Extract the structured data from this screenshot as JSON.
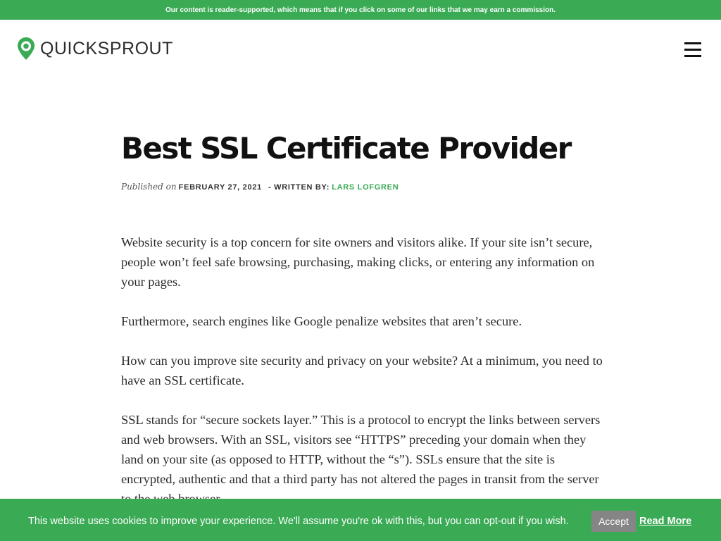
{
  "top_notice": "Our content is reader-supported, which means that if you click on some of our links that we may earn a commission.",
  "logo": {
    "text": "QUICKSPROUT",
    "icon": "quicksprout-pin-logo",
    "color": "#3aaa55"
  },
  "menu": {
    "icon": "hamburger-menu-icon"
  },
  "article": {
    "title": "Best SSL Certificate Provider",
    "published_label": "Published on",
    "date": "February 27, 2021",
    "written_by_label": "- WRITTEN BY:",
    "author": "LARS LOFGREN",
    "paragraphs": [
      "Website security is a top concern for site owners and visitors alike. If your site isn’t secure, people won’t feel safe browsing, purchasing, making clicks, or entering any information on your pages.",
      "Furthermore, search engines like Google penalize websites that aren’t secure.",
      "How can you improve site security and privacy on your website? At a minimum, you need to have an SSL certificate.",
      "SSL stands for “secure sockets layer.” This is a protocol to encrypt the links between servers and web browsers. With an SSL, visitors see “HTTPS” preceding your domain when they land on your site (as opposed to HTTP, without the “s”). SSLs ensure that the site is encrypted, authentic and that a third party has not altered the pages in transit from the server to the web browser."
    ]
  },
  "cookie_bar": {
    "message": "This website uses cookies to improve your experience. We'll assume you're ok with this, but you can opt-out if you wish.",
    "accept_label": "Accept",
    "read_more_label": "Read More"
  },
  "colors": {
    "brand_green": "#3aaa55",
    "accept_gray": "#858585",
    "title_black": "#111111"
  }
}
